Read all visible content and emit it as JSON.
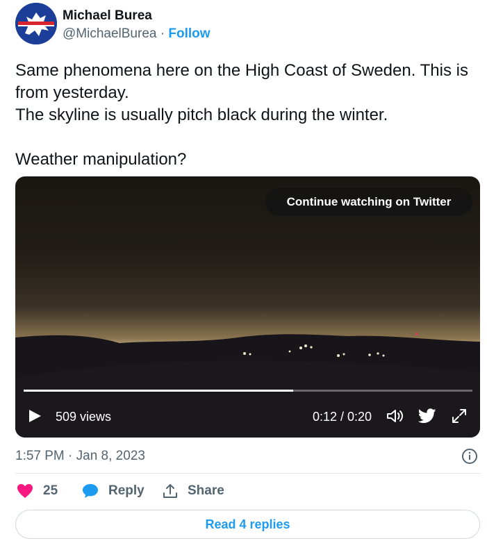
{
  "author": {
    "name": "Michael Burea",
    "handle": "@MichaelBurea",
    "separator": " · ",
    "follow_label": "Follow"
  },
  "tweet": {
    "line1": "Same phenomena here on the High Coast of Sweden. This is from yesterday.",
    "line2": "The skyline is usually pitch black during the winter.",
    "line3": "Weather manipulation?"
  },
  "video": {
    "continue_label": "Continue watching on Twitter",
    "views": "509 views",
    "time": "0:12 / 0:20",
    "progress_fraction": 0.6
  },
  "meta": {
    "timestamp": "1:57 PM · Jan 8, 2023"
  },
  "actions": {
    "likes": "25",
    "reply_label": "Reply",
    "share_label": "Share",
    "read_replies_label": "Read 4 replies"
  },
  "colors": {
    "accent": "#1d9bf0",
    "like": "#f91880",
    "text": "#0f1419",
    "muted": "#536471"
  }
}
